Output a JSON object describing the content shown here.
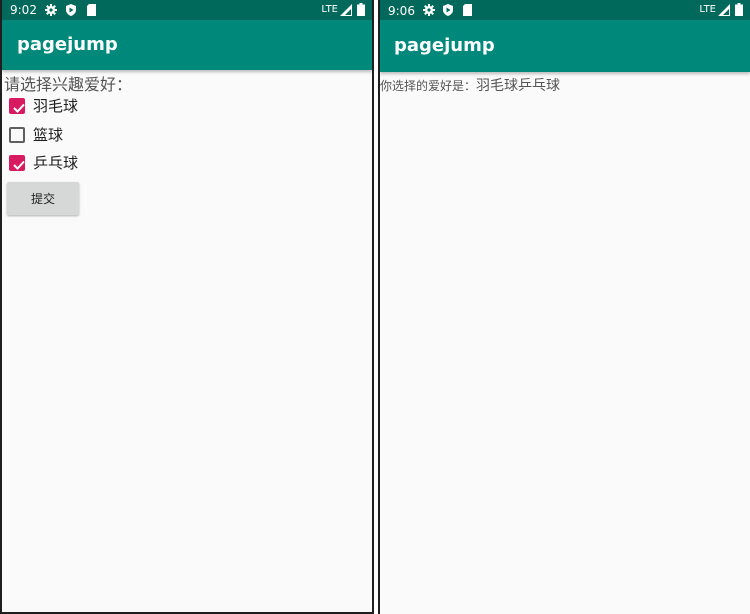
{
  "left_screen": {
    "status": {
      "time": "9:02",
      "network": "LTE"
    },
    "app_title": "pagejump",
    "prompt": "请选择兴趣爱好：",
    "hobbies": [
      {
        "label": "羽毛球",
        "checked": true
      },
      {
        "label": "篮球",
        "checked": false
      },
      {
        "label": "乒乓球",
        "checked": true
      }
    ],
    "submit_label": "提交"
  },
  "right_screen": {
    "status": {
      "time": "9:06",
      "network": "LTE"
    },
    "app_title": "pagejump",
    "result_label": "你选择的爱好是：",
    "result_value": "羽毛球乒乓球"
  },
  "colors": {
    "status_bar": "#00695c",
    "app_bar": "#00897b",
    "checkbox_accent": "#d81b60",
    "button_bg": "#d6d7d7"
  },
  "icons": [
    "settings-icon",
    "shield-icon",
    "sd-card-icon",
    "signal-icon",
    "battery-icon",
    "check-icon"
  ]
}
